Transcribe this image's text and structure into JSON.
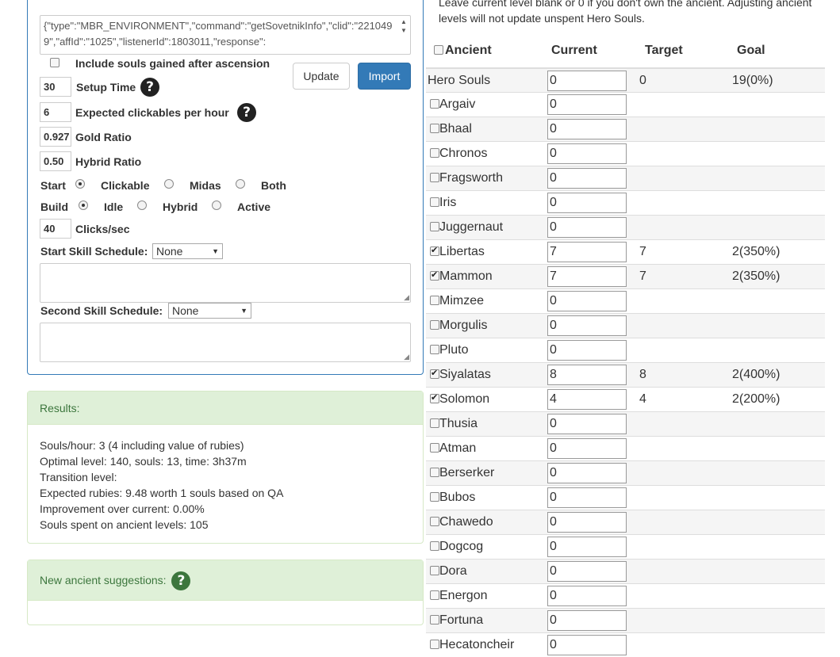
{
  "import_text": "{\"type\":\"MBR_ENVIRONMENT\",\"command\":\"getSovetnikInfo\",\"clid\":\"2210499\",\"affId\":\"1025\",\"listenerId\":1803011,\"response\":",
  "settings": {
    "include_souls_label": "Include souls gained after ascension",
    "update_label": "Update",
    "import_label": "Import",
    "setup_time": {
      "value": "30",
      "label": "Setup Time"
    },
    "clickables": {
      "value": "6",
      "label": "Expected clickables per hour"
    },
    "gold_ratio": {
      "value": "0.927",
      "label": "Gold Ratio"
    },
    "hybrid_ratio": {
      "value": "0.50",
      "label": "Hybrid Ratio"
    },
    "start": {
      "label": "Start",
      "options": [
        "Clickable",
        "Midas",
        "Both"
      ],
      "selected": "Clickable"
    },
    "build": {
      "label": "Build",
      "options": [
        "Idle",
        "Hybrid",
        "Active"
      ],
      "selected": "Idle"
    },
    "clicks": {
      "value": "40",
      "label": "Clicks/sec"
    },
    "start_schedule": {
      "label": "Start Skill Schedule:",
      "value": "None"
    },
    "second_schedule": {
      "label": "Second Skill Schedule:",
      "value": "None"
    }
  },
  "results": {
    "heading": "Results:",
    "lines": [
      "Souls/hour: 3 (4 including value of rubies)",
      "Optimal level: 140, souls: 13, time: 3h37m",
      "Transition level:",
      "Expected rubies: 9.48 worth 1 souls based on QA",
      "Improvement over current: 0.00%",
      "Souls spent on ancient levels: 105"
    ]
  },
  "suggestions": {
    "heading": "New ancient suggestions:"
  },
  "intro_text": "Leave current level blank or 0 if you don't own the ancient. Adjusting ancient levels will not update unspent Hero Souls.",
  "table": {
    "headers": {
      "ancient": "Ancient",
      "current": "Current",
      "target": "Target",
      "goal": "Goal"
    },
    "hero_souls": {
      "name": "Hero Souls",
      "current": "0",
      "target": "0",
      "goal": "19(0%)"
    },
    "rows": [
      {
        "name": "Argaiv",
        "checked": false,
        "current": "0",
        "target": "",
        "goal": ""
      },
      {
        "name": "Bhaal",
        "checked": false,
        "current": "0",
        "target": "",
        "goal": ""
      },
      {
        "name": "Chronos",
        "checked": false,
        "current": "0",
        "target": "",
        "goal": ""
      },
      {
        "name": "Fragsworth",
        "checked": false,
        "current": "0",
        "target": "",
        "goal": ""
      },
      {
        "name": "Iris",
        "checked": false,
        "current": "0",
        "target": "",
        "goal": ""
      },
      {
        "name": "Juggernaut",
        "checked": false,
        "current": "0",
        "target": "",
        "goal": ""
      },
      {
        "name": "Libertas",
        "checked": true,
        "current": "7",
        "target": "7",
        "goal": "2(350%)"
      },
      {
        "name": "Mammon",
        "checked": true,
        "current": "7",
        "target": "7",
        "goal": "2(350%)"
      },
      {
        "name": "Mimzee",
        "checked": false,
        "current": "0",
        "target": "",
        "goal": ""
      },
      {
        "name": "Morgulis",
        "checked": false,
        "current": "0",
        "target": "",
        "goal": ""
      },
      {
        "name": "Pluto",
        "checked": false,
        "current": "0",
        "target": "",
        "goal": ""
      },
      {
        "name": "Siyalatas",
        "checked": true,
        "current": "8",
        "target": "8",
        "goal": "2(400%)"
      },
      {
        "name": "Solomon",
        "checked": true,
        "current": "4",
        "target": "4",
        "goal": "2(200%)"
      },
      {
        "name": "Thusia",
        "checked": false,
        "current": "0",
        "target": "",
        "goal": ""
      },
      {
        "name": "Atman",
        "checked": false,
        "current": "0",
        "target": "",
        "goal": ""
      },
      {
        "name": "Berserker",
        "checked": false,
        "current": "0",
        "target": "",
        "goal": ""
      },
      {
        "name": "Bubos",
        "checked": false,
        "current": "0",
        "target": "",
        "goal": ""
      },
      {
        "name": "Chawedo",
        "checked": false,
        "current": "0",
        "target": "",
        "goal": ""
      },
      {
        "name": "Dogcog",
        "checked": false,
        "current": "0",
        "target": "",
        "goal": ""
      },
      {
        "name": "Dora",
        "checked": false,
        "current": "0",
        "target": "",
        "goal": ""
      },
      {
        "name": "Energon",
        "checked": false,
        "current": "0",
        "target": "",
        "goal": ""
      },
      {
        "name": "Fortuna",
        "checked": false,
        "current": "0",
        "target": "",
        "goal": ""
      },
      {
        "name": "Hecatoncheir",
        "checked": false,
        "current": "0",
        "target": "",
        "goal": ""
      }
    ]
  }
}
